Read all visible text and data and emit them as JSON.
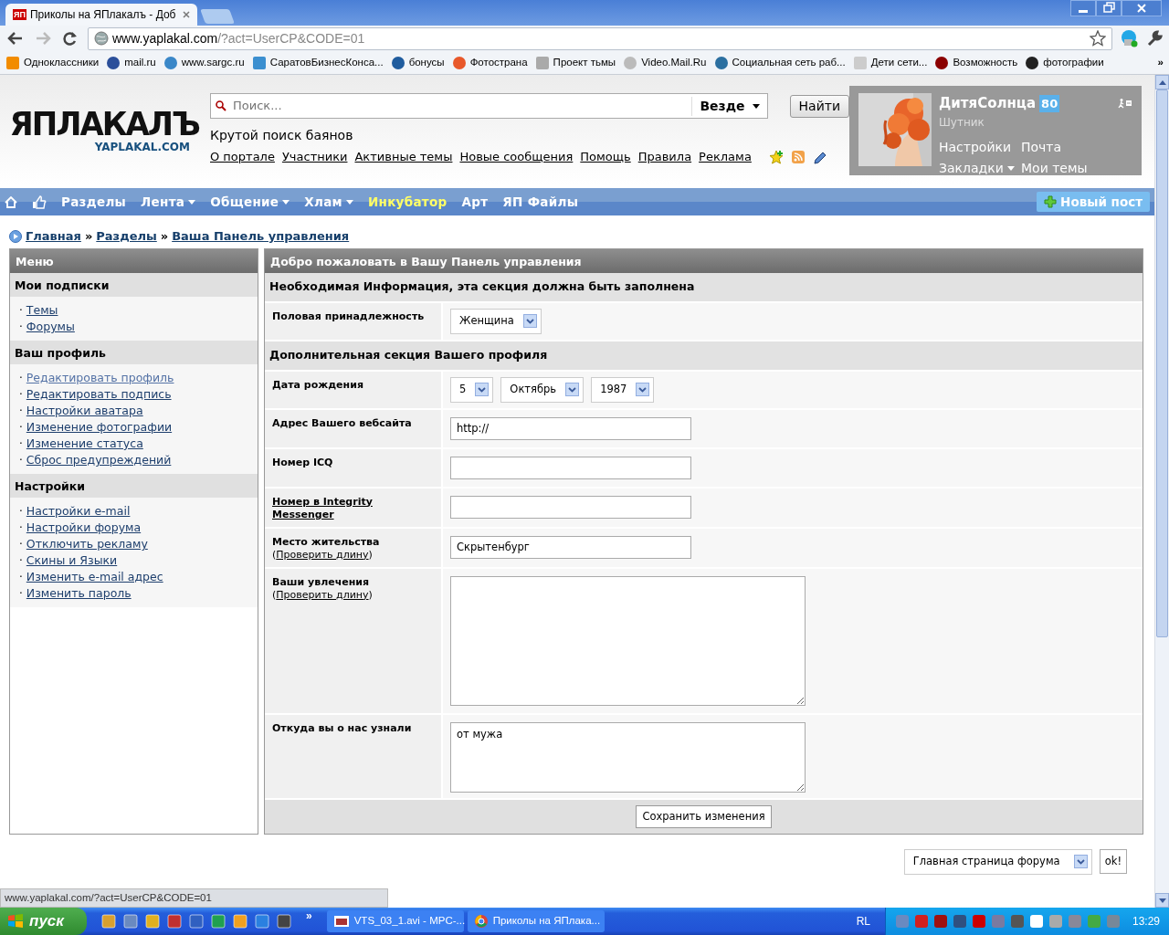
{
  "browser": {
    "favicon": "ЯП",
    "tab_title": "Приколы на ЯПлакалъ - Доб",
    "url_host": "www.yaplakal.com",
    "url_path": "/?act=UserCP&CODE=01",
    "bookmarks_more": "»",
    "bookmarks": [
      {
        "label": "Одноклассники"
      },
      {
        "label": "mail.ru"
      },
      {
        "label": "www.sargc.ru"
      },
      {
        "label": "СаратовБизнесКонса..."
      },
      {
        "label": "бонусы"
      },
      {
        "label": "Фотострана"
      },
      {
        "label": "Проект тьмы"
      },
      {
        "label": "Video.Mail.Ru"
      },
      {
        "label": "Социальная сеть раб..."
      },
      {
        "label": "Дети сети..."
      },
      {
        "label": "Возможность"
      },
      {
        "label": "фотографии"
      }
    ]
  },
  "header": {
    "logo_main": "ЯПЛАКАЛЪ",
    "logo_sub": "YAPLAKAL.COM",
    "search_placeholder": "Поиск...",
    "search_scope": "Везде",
    "search_button": "Найти",
    "tagline": "Крутой поиск баянов",
    "links": [
      "О портале",
      "Участники",
      "Активные темы",
      "Новые сообщения",
      "Помощь",
      "Правила",
      "Реклама"
    ]
  },
  "user": {
    "name": "ДитяСолнца",
    "karma": "80",
    "rank": "Шутник",
    "links": [
      {
        "label": "Настройки",
        "dropdown": false
      },
      {
        "label": "Почта",
        "dropdown": false
      },
      {
        "label": "Закладки",
        "dropdown": true
      },
      {
        "label": "Мои темы",
        "dropdown": false
      }
    ]
  },
  "navbar": {
    "items": [
      {
        "label": "Разделы",
        "dropdown": false,
        "highlight": false
      },
      {
        "label": "Лента",
        "dropdown": true,
        "highlight": false
      },
      {
        "label": "Общение",
        "dropdown": true,
        "highlight": false
      },
      {
        "label": "Хлам",
        "dropdown": true,
        "highlight": false
      },
      {
        "label": "Инкубатор",
        "dropdown": false,
        "highlight": true
      },
      {
        "label": "Арт",
        "dropdown": false,
        "highlight": false
      },
      {
        "label": "ЯП Файлы",
        "dropdown": false,
        "highlight": false
      }
    ],
    "new_post": "Новый пост"
  },
  "breadcrumbs": {
    "separator": "»",
    "items": [
      "Главная",
      "Разделы",
      "Ваша Панель управления"
    ]
  },
  "sidebar": {
    "title": "Меню",
    "bullet": "·",
    "sections": [
      {
        "title": "Мои подписки",
        "items": [
          {
            "label": "Темы",
            "selected": false
          },
          {
            "label": "Форумы",
            "selected": false
          }
        ]
      },
      {
        "title": "Ваш профиль",
        "items": [
          {
            "label": "Редактировать профиль",
            "selected": true
          },
          {
            "label": "Редактировать подпись",
            "selected": false
          },
          {
            "label": "Настройки аватара",
            "selected": false
          },
          {
            "label": "Изменение фотографии",
            "selected": false
          },
          {
            "label": "Изменение статуса",
            "selected": false
          },
          {
            "label": "Сброс предупреждений",
            "selected": false
          }
        ]
      },
      {
        "title": "Настройки",
        "items": [
          {
            "label": "Настройки e-mail",
            "selected": false
          },
          {
            "label": "Настройки форума",
            "selected": false
          },
          {
            "label": "Отключить рекламу",
            "selected": false
          },
          {
            "label": "Скины и Языки",
            "selected": false
          },
          {
            "label": "Изменить e-mail адрес",
            "selected": false
          },
          {
            "label": "Изменить пароль",
            "selected": false
          }
        ]
      }
    ]
  },
  "form": {
    "title": "Добро пожаловать в Вашу Панель управления",
    "submit": "Сохранить изменения",
    "sections": [
      {
        "title": "Необходимая Информация, эта секция должна быть заполнена",
        "rows": [
          {
            "kind": "select",
            "label": "Половая принадлежность",
            "selects": [
              "Женщина"
            ]
          }
        ]
      },
      {
        "title": "Дополнительная секция Вашего профиля",
        "rows": [
          {
            "kind": "select",
            "label": "Дата рождения",
            "selects": [
              "5",
              "Октябрь",
              "1987"
            ]
          },
          {
            "kind": "input",
            "label": "Адрес Вашего вебсайта",
            "value": "http://"
          },
          {
            "kind": "input",
            "label": "Номер ICQ"
          },
          {
            "kind": "input",
            "label": "Номер в Integrity Messenger",
            "label_link": true
          },
          {
            "kind": "input",
            "label": "Место жительства",
            "note_prefix": "(",
            "note_link": "Проверить длину",
            "note_suffix": ")",
            "value": "Скрытенбург"
          },
          {
            "kind": "textarea",
            "label": "Ваши увлечения",
            "note_prefix": "(",
            "note_link": "Проверить длину",
            "note_suffix": ")",
            "large": true
          },
          {
            "kind": "textarea",
            "label": "Откуда вы о нас узнали",
            "value": "от мужа",
            "large": false
          }
        ]
      }
    ]
  },
  "jump": {
    "select": "Главная страница форума",
    "button": "ok!"
  },
  "status_url": "www.yaplakal.com/?act=UserCP&CODE=01",
  "taskbar": {
    "start": "пуск",
    "more": "»",
    "tasks": [
      {
        "label": "VTS_03_1.avi - MPC-..."
      },
      {
        "label": "Приколы на ЯПлака..."
      }
    ],
    "lang": "RL",
    "clock": "13:29"
  }
}
